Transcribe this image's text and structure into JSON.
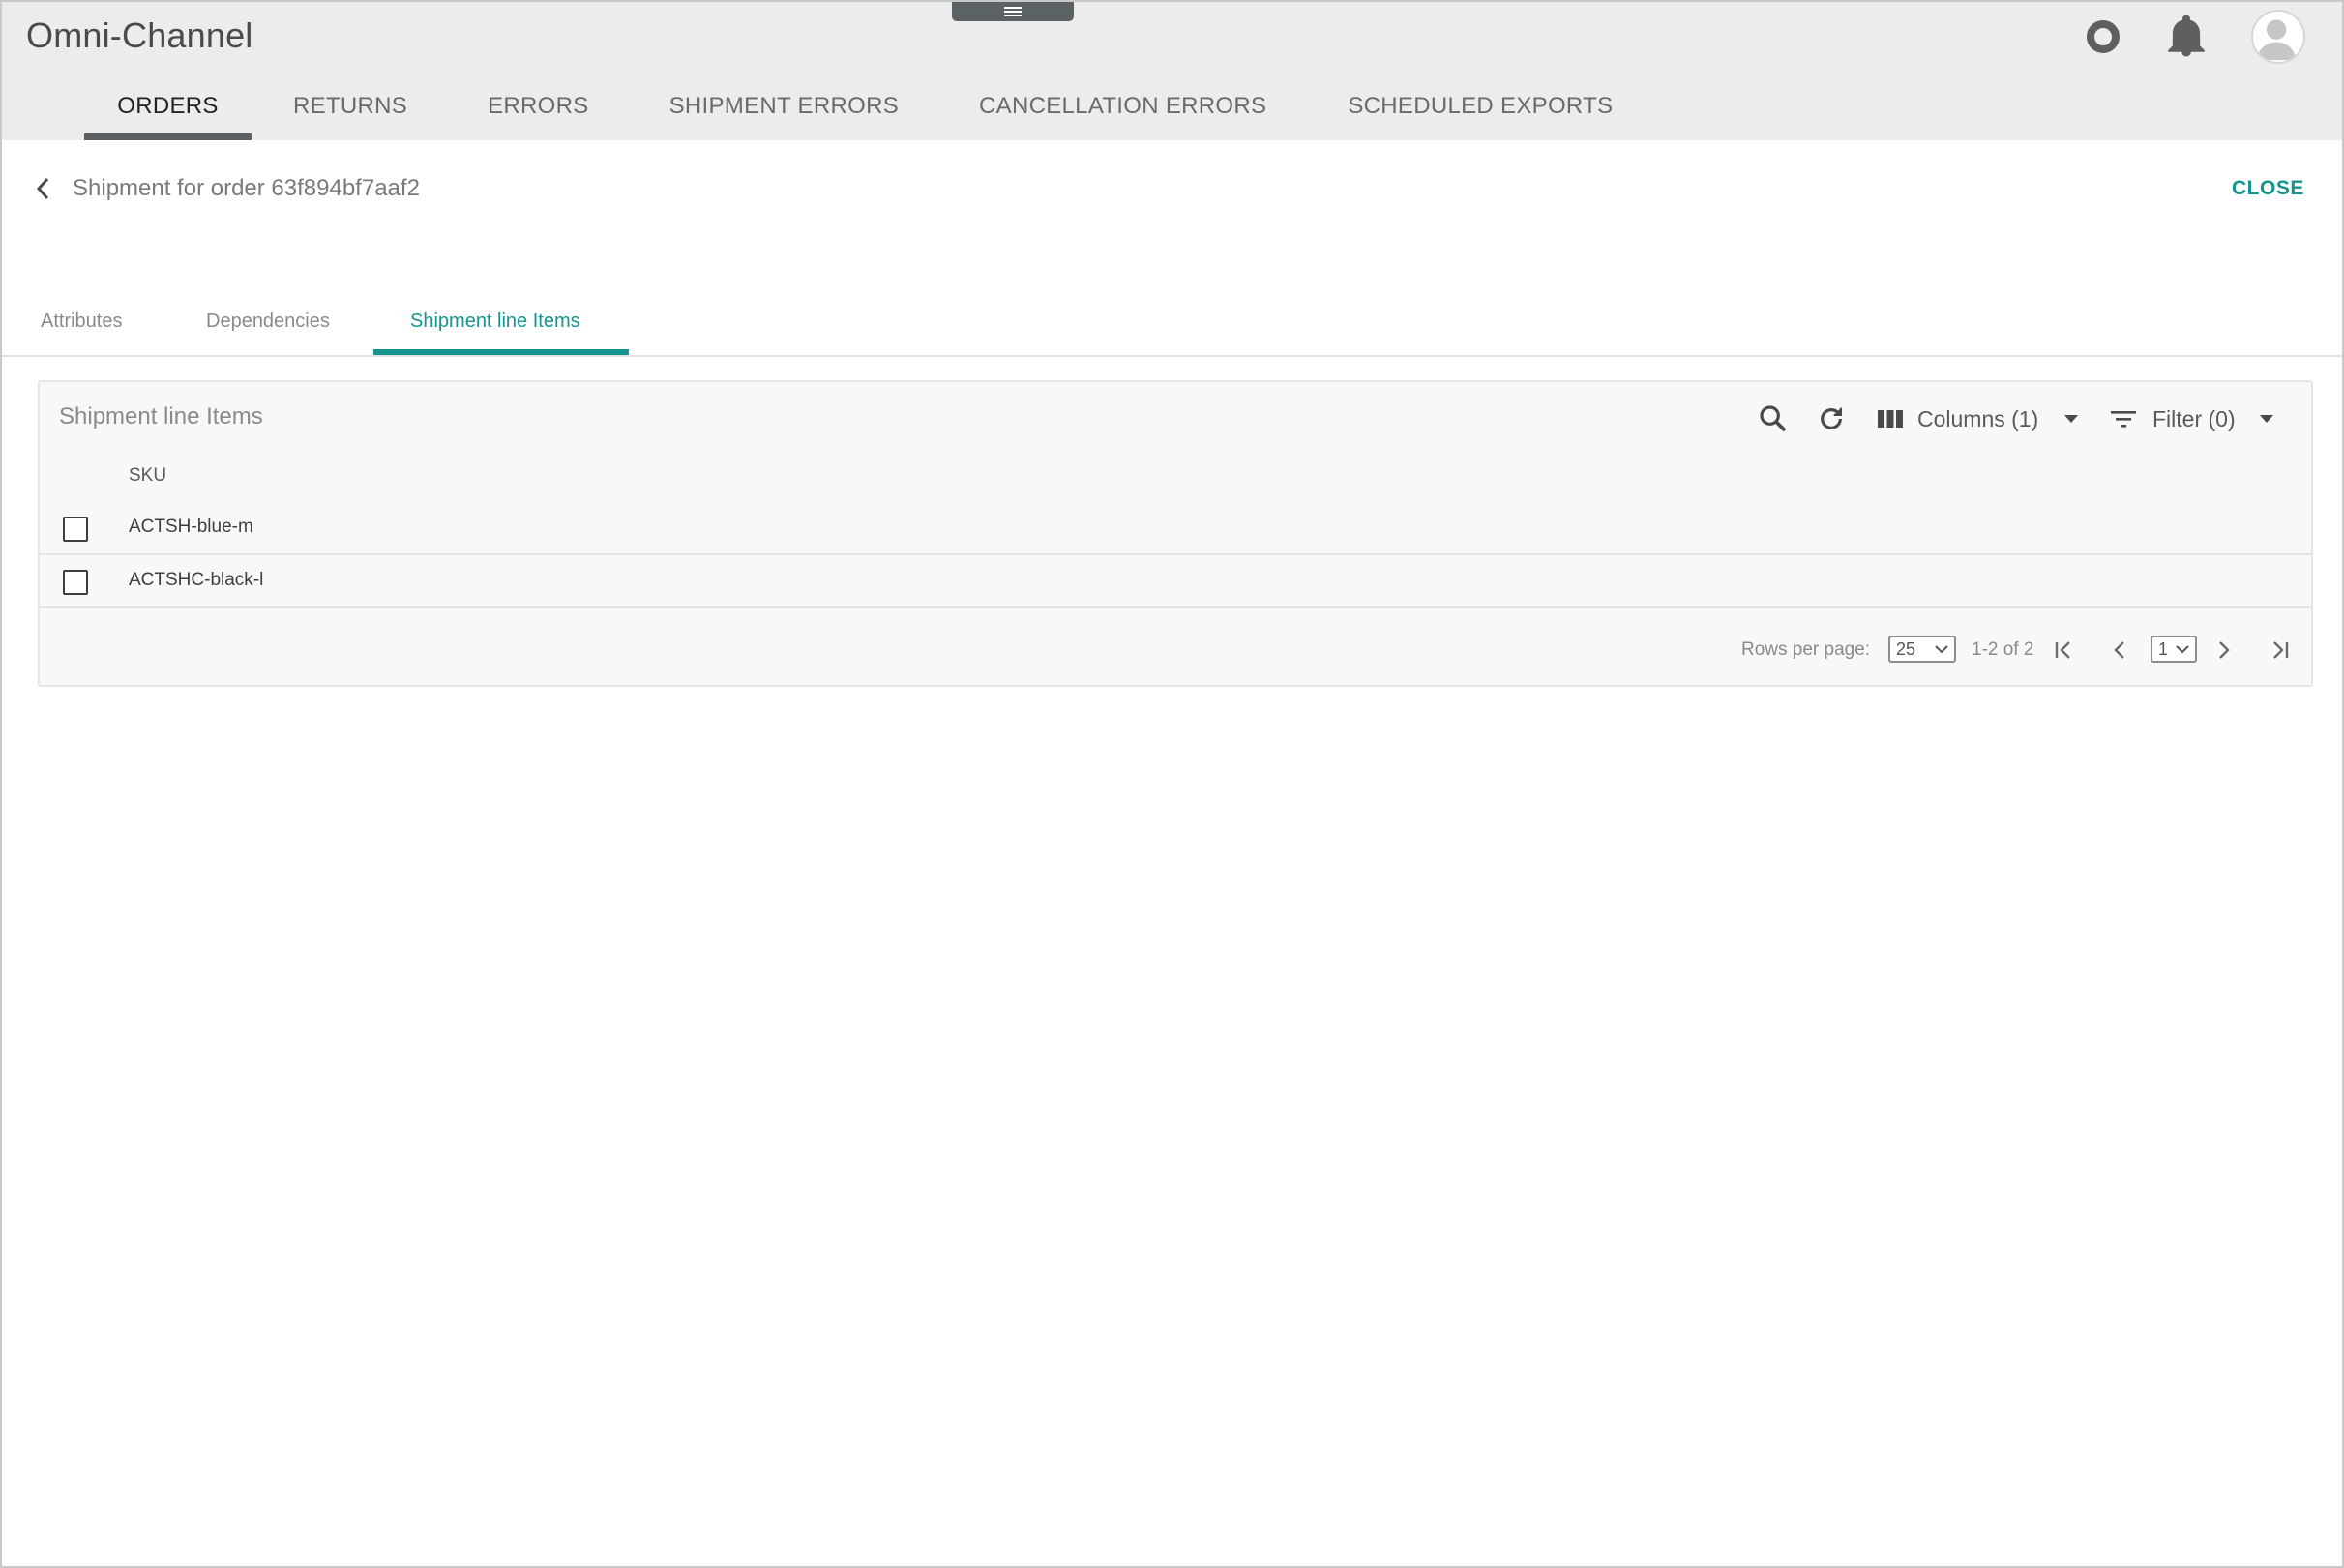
{
  "header": {
    "app_title": "Omni-Channel",
    "icons": [
      "circle-icon",
      "bell-icon",
      "avatar-icon"
    ],
    "nav_tabs": [
      {
        "label": "ORDERS",
        "active": true
      },
      {
        "label": "RETURNS",
        "active": false
      },
      {
        "label": "ERRORS",
        "active": false
      },
      {
        "label": "SHIPMENT ERRORS",
        "active": false
      },
      {
        "label": "CANCELLATION ERRORS",
        "active": false
      },
      {
        "label": "SCHEDULED EXPORTS",
        "active": false
      }
    ]
  },
  "detail": {
    "title": "Shipment for order 63f894bf7aaf2",
    "close_label": "CLOSE",
    "tabs": [
      {
        "label": "Attributes",
        "active": false
      },
      {
        "label": "Dependencies",
        "active": false
      },
      {
        "label": "Shipment line Items",
        "active": true
      }
    ]
  },
  "grid": {
    "title": "Shipment line Items",
    "columns_label": "Columns (1)",
    "filter_label": "Filter (0)",
    "column_headers": [
      "SKU"
    ],
    "rows": [
      {
        "sku": "ACTSH-blue-m",
        "checked": false
      },
      {
        "sku": "ACTSHC-black-l",
        "checked": false
      }
    ],
    "pagination": {
      "rows_per_page_label": "Rows per page:",
      "rows_per_page_value": "25",
      "range_text": "1-2 of 2",
      "page_value": "1"
    }
  },
  "colors": {
    "accent": "#13948f",
    "header_bg": "#ececec",
    "nav_indicator": "#5a5f63"
  }
}
